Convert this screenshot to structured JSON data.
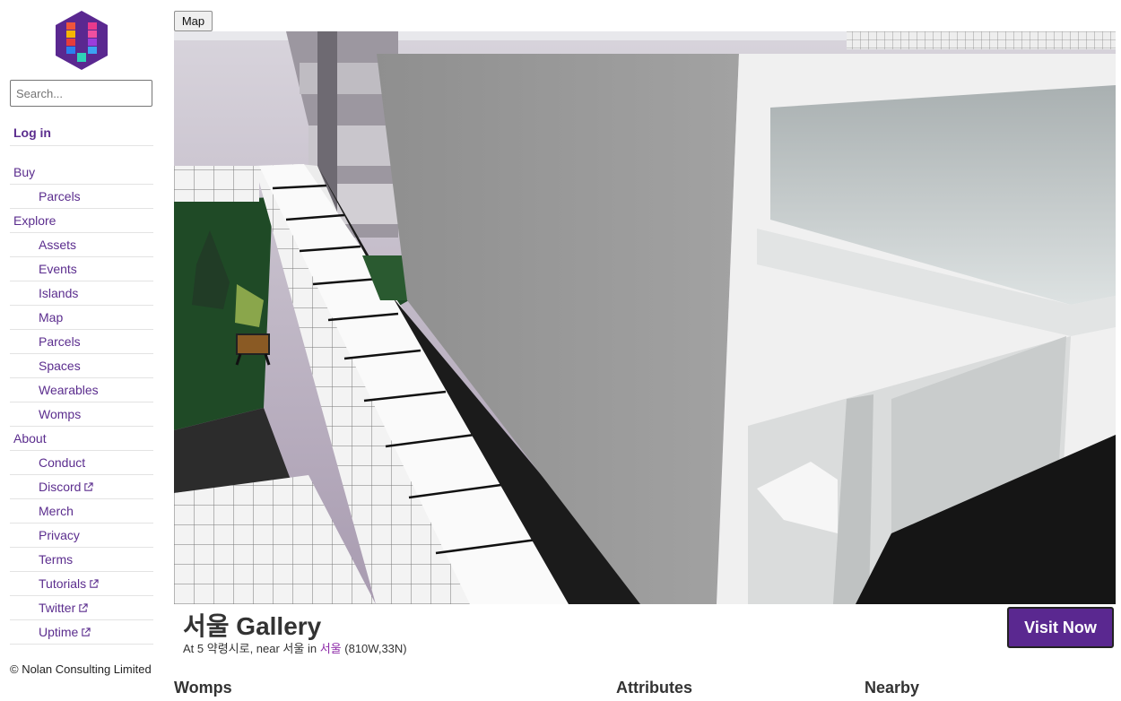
{
  "search": {
    "placeholder": "Search..."
  },
  "nav": {
    "login": "Log in",
    "buy": "Buy",
    "buy_items": [
      "Parcels"
    ],
    "explore": "Explore",
    "explore_items": [
      "Assets",
      "Events",
      "Islands",
      "Map",
      "Parcels",
      "Spaces",
      "Wearables",
      "Womps"
    ],
    "about": "About",
    "about_items": [
      "Conduct",
      "Discord",
      "Merch",
      "Privacy",
      "Terms",
      "Tutorials",
      "Twitter",
      "Uptime"
    ]
  },
  "footer": {
    "copyright": "© Nolan Consulting Limited"
  },
  "map_button": "Map",
  "parcel": {
    "title": "서울 Gallery",
    "at_prefix": "At 5 약령시로, near 서울 in",
    "island_link": "서울",
    "coords": "(810W,33N)",
    "visit_label": "Visit Now"
  },
  "sections": {
    "womps": "Womps",
    "attributes": "Attributes",
    "nearby": "Nearby"
  },
  "colors": {
    "brand": "#5a2890",
    "link": "#5b2d8e",
    "accent_link": "#8d2aa8"
  }
}
